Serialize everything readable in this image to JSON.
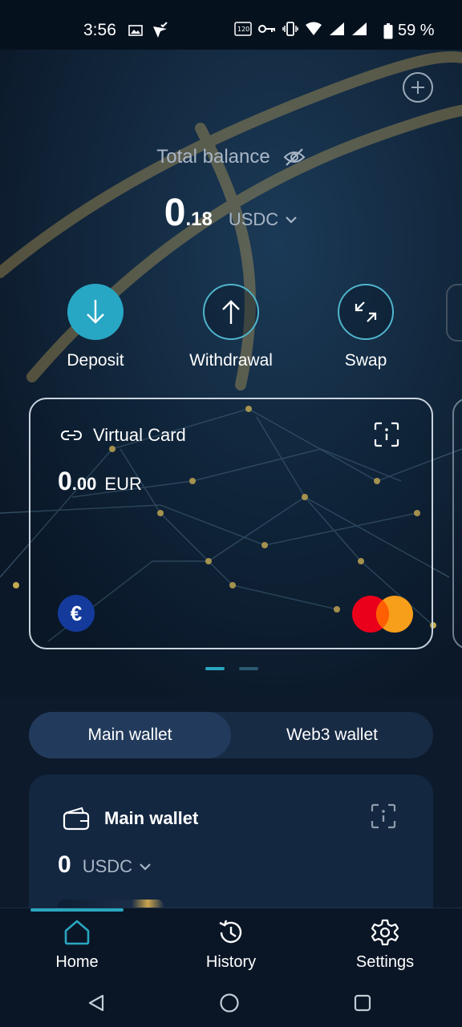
{
  "status_bar": {
    "time": "3:56",
    "battery": "59 %",
    "left_icons": [
      "image-icon",
      "location-check-icon"
    ],
    "right_icons": [
      "refresh-rate-icon",
      "key-icon",
      "vibrate-icon",
      "wifi-icon",
      "signal-icon",
      "signal-2-icon",
      "battery-icon"
    ]
  },
  "header": {
    "balance_label": "Total balance",
    "balance_whole": "0",
    "balance_fraction": ".18",
    "balance_currency": "USDC"
  },
  "actions": [
    {
      "label": "Deposit",
      "icon": "arrow-down-icon"
    },
    {
      "label": "Withdrawal",
      "icon": "arrow-up-icon"
    },
    {
      "label": "Swap",
      "icon": "swap-arrows-icon"
    }
  ],
  "card": {
    "title": "Virtual Card",
    "amount_whole": "0",
    "amount_fraction": ".00",
    "currency": "EUR",
    "currency_symbol": "€"
  },
  "pager": {
    "pages": 2,
    "active": 0
  },
  "wallet_toggle": {
    "main": "Main wallet",
    "web3": "Web3 wallet",
    "active": "main"
  },
  "wallet": {
    "title": "Main wallet",
    "amount": "0",
    "currency": "USDC"
  },
  "bottom_nav": {
    "items": [
      {
        "label": "Home",
        "icon": "home-icon"
      },
      {
        "label": "History",
        "icon": "history-icon"
      },
      {
        "label": "Settings",
        "icon": "settings-icon"
      }
    ],
    "active": "Home"
  },
  "colors": {
    "accent": "#27a7c4",
    "background": "#0d1a2b",
    "card_border": "#c9d3dd",
    "toggle_active": "#223b5c",
    "mastercard_red": "#eb001b",
    "mastercard_orange": "#f79e1b",
    "euro_badge": "#143b9c"
  }
}
